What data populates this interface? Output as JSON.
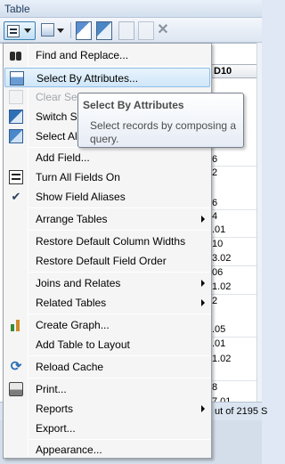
{
  "window": {
    "title": "Table"
  },
  "toolbar": {
    "table_options_icon": "table-options-icon",
    "related_tables_icon": "related-tables-icon",
    "buttons": [
      "select-by-attributes-icon",
      "switch-selection-icon",
      "clear-selection-icon",
      "zoom-to-selected-icon",
      "delete-selected-icon"
    ]
  },
  "grid": {
    "column_header": "D10",
    "cells": [
      "6",
      "2",
      "6",
      "4",
      ".01",
      "10",
      "3.02",
      "06",
      "1.02",
      "2",
      ".05",
      ".01",
      "1.02",
      "8",
      "7.01"
    ]
  },
  "status": {
    "text": "ut of 2195 S"
  },
  "menu": {
    "items": [
      {
        "label": "Find and Replace...",
        "icon": "binoculars-icon"
      },
      {
        "label": "Select By Attributes...",
        "icon": "select-by-attributes-icon",
        "highlighted": true
      },
      {
        "label": "Clear Sele",
        "icon": "clear-selection-icon",
        "disabled": true
      },
      {
        "label": "Switch Se",
        "icon": "switch-selection-icon"
      },
      {
        "label": "Select All",
        "icon": "select-all-icon"
      },
      {
        "label": "Add Field..."
      },
      {
        "label": "Turn All Fields On",
        "icon": "fields-list-icon"
      },
      {
        "label": "Show Field Aliases",
        "icon": "checkmark-icon",
        "checked": true
      },
      {
        "label": "Arrange Tables",
        "submenu": true
      },
      {
        "label": "Restore Default Column Widths"
      },
      {
        "label": "Restore Default Field Order"
      },
      {
        "label": "Joins and Relates",
        "submenu": true
      },
      {
        "label": "Related Tables",
        "submenu": true
      },
      {
        "label": "Create Graph...",
        "icon": "bar-chart-icon"
      },
      {
        "label": "Add Table to Layout"
      },
      {
        "label": "Reload Cache",
        "icon": "reload-icon"
      },
      {
        "label": "Print...",
        "icon": "printer-icon"
      },
      {
        "label": "Reports",
        "submenu": true
      },
      {
        "label": "Export..."
      },
      {
        "label": "Appearance..."
      }
    ]
  },
  "tooltip": {
    "title": "Select By Attributes",
    "description": "Select records by composing a query."
  }
}
